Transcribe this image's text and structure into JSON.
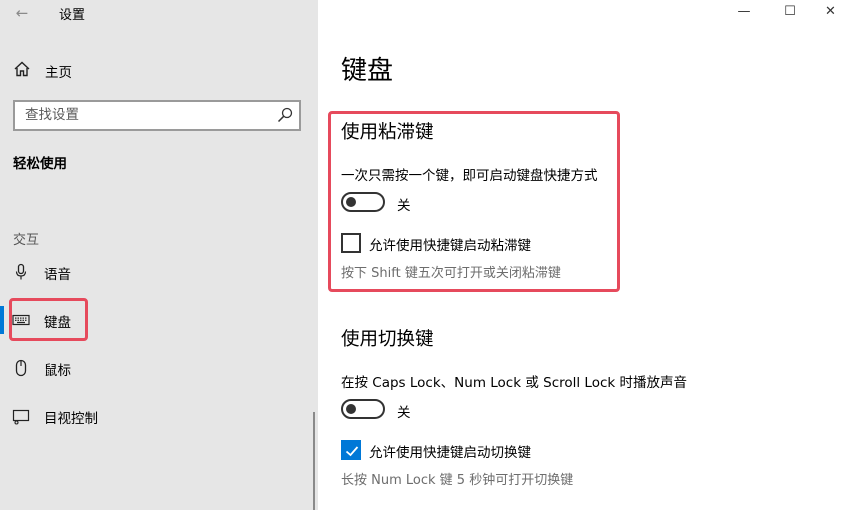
{
  "window": {
    "title": "设置",
    "controls": {
      "minimize": "—",
      "maximize": "☐",
      "close": "✕"
    }
  },
  "sidebar": {
    "back_icon": "arrow-left-icon",
    "home_label": "主页",
    "search_placeholder": "查找设置",
    "section_title": "轻松使用",
    "group_title": "交互",
    "items": [
      {
        "label": "语音",
        "icon": "microphone-icon"
      },
      {
        "label": "键盘",
        "icon": "keyboard-icon",
        "active": true
      },
      {
        "label": "鼠标",
        "icon": "mouse-icon"
      },
      {
        "label": "目视控制",
        "icon": "eye-control-icon"
      }
    ]
  },
  "main": {
    "page_title": "键盘",
    "sticky_keys": {
      "heading": "使用粘滞键",
      "description": "一次只需按一个键，即可启动键盘快捷方式",
      "toggle_state_label": "关",
      "checkbox_label": "允许使用快捷键启动粘滞键",
      "checkbox_checked": false,
      "hint": "按下 Shift 键五次可打开或关闭粘滞键"
    },
    "toggle_keys": {
      "heading": "使用切换键",
      "description": "在按 Caps Lock、Num Lock 或 Scroll Lock 时播放声音",
      "toggle_state_label": "关",
      "checkbox_label": "允许使用快捷键启动切换键",
      "checkbox_checked": true,
      "hint": "长按 Num Lock 键 5 秒钟可打开切换键"
    }
  },
  "colors": {
    "accent": "#0078d7",
    "highlight": "#e64a5c",
    "sidebar_bg": "#e6e6e6"
  }
}
